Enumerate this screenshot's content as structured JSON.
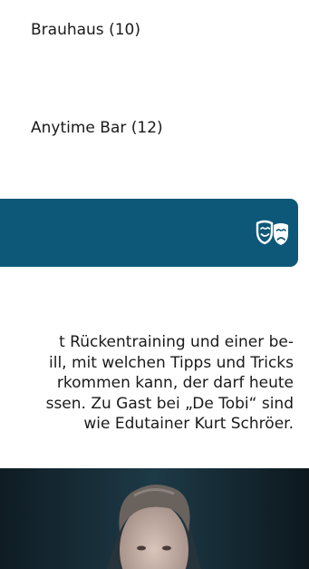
{
  "venues": [
    {
      "name": "Brauhaus (10)"
    },
    {
      "name": "Anytime Bar (12)"
    }
  ],
  "category_bar": {
    "color": "#0d5878",
    "icon": "theater-masks-icon"
  },
  "event": {
    "description": "t Rückentraining und einer be-\nill, mit welchen Tipps und Tricks\nrkommen kann, der darf heute\nssen. Zu Gast bei „De Tobi“ sind\nwie Edutainer Kurt Schröer."
  }
}
